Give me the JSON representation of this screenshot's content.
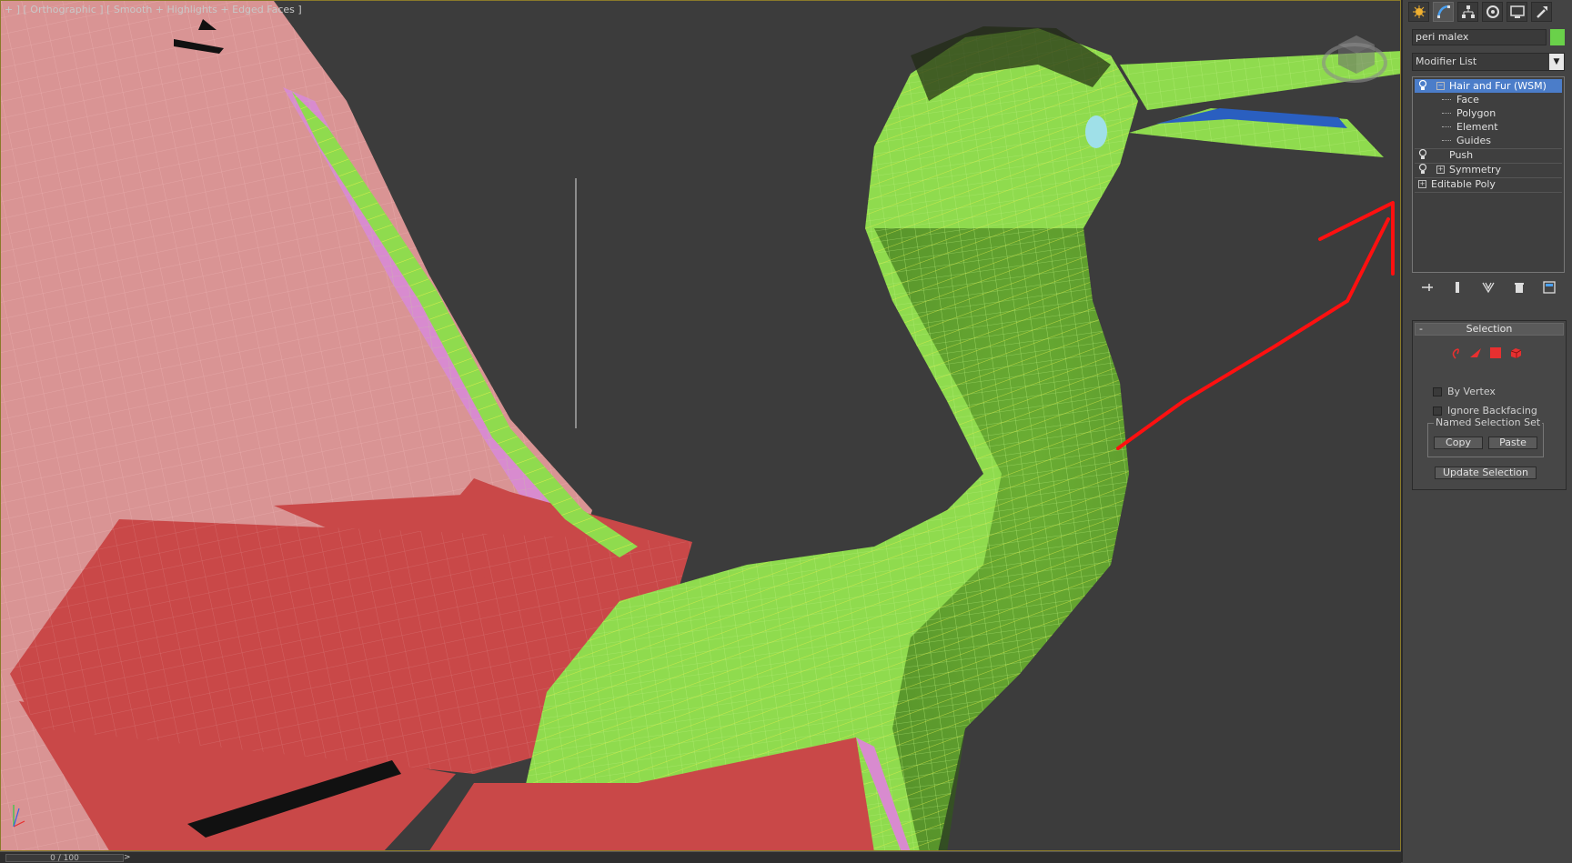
{
  "viewport": {
    "label": "+ ] [ Orthographic ] [ Smooth + Highlights + Edged Faces ]"
  },
  "timeline": {
    "frame": "0 / 100",
    "arrow": ">"
  },
  "panel": {
    "tabs": [
      {
        "icon": "create-icon"
      },
      {
        "icon": "modify-icon"
      },
      {
        "icon": "hierarchy-icon"
      },
      {
        "icon": "motion-icon"
      },
      {
        "icon": "display-icon"
      },
      {
        "icon": "utilities-icon"
      }
    ],
    "object_name": "peri malex",
    "object_color": "#6ad14a",
    "modifier_list": "Modifier List",
    "stack": {
      "hair": "Hair and Fur (WSM)",
      "face": "Face",
      "polygon": "Polygon",
      "element": "Element",
      "guides": "Guides",
      "push": "Push",
      "symmetry": "Symmetry",
      "editable_poly": "Editable Poly"
    },
    "selection": {
      "title": "Selection",
      "collapse": "-",
      "by_vertex": "By Vertex",
      "ignore_backfacing": "Ignore Backfacing",
      "named_set": "Named Selection Set",
      "copy": "Copy",
      "paste": "Paste",
      "update": "Update Selection"
    }
  }
}
